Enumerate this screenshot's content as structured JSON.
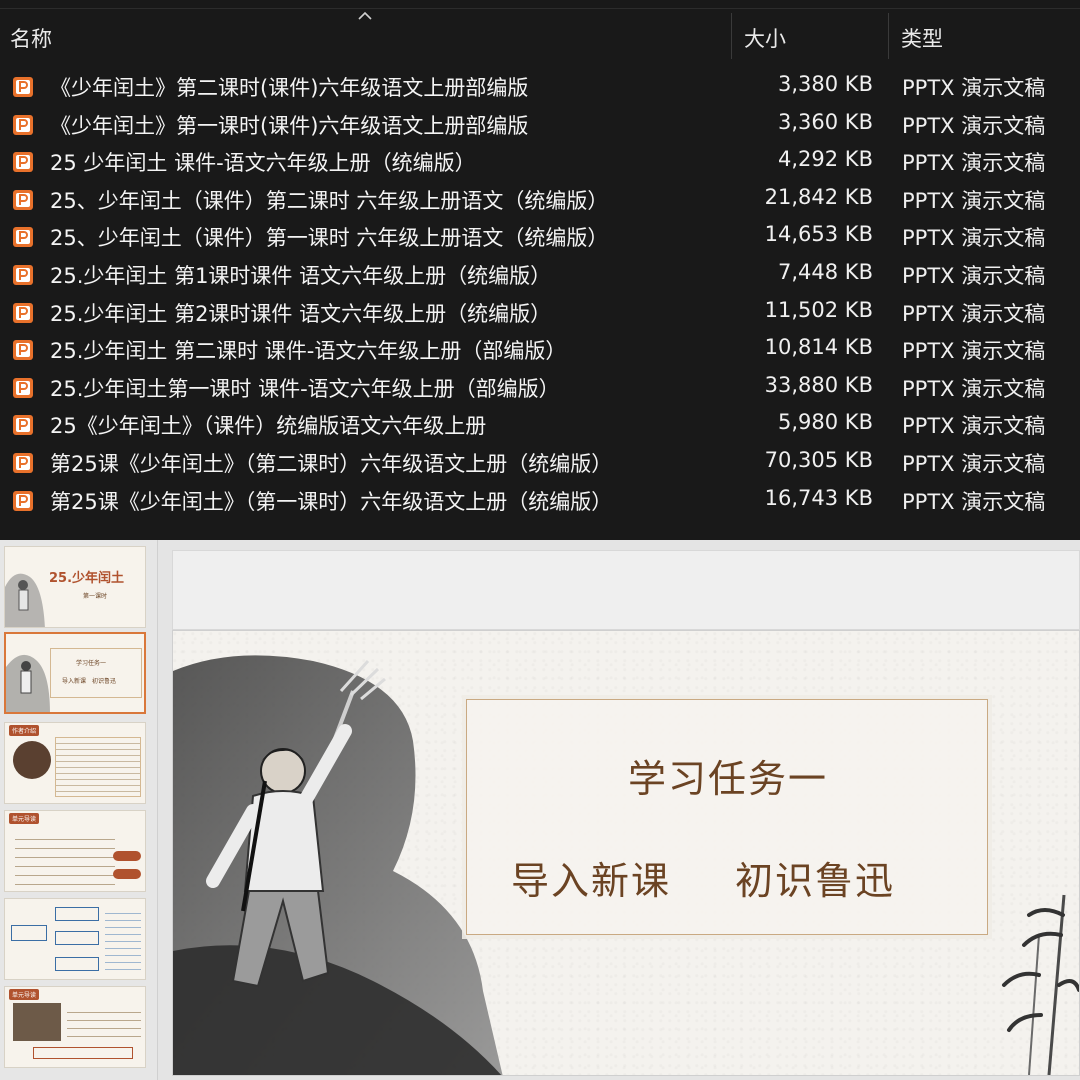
{
  "explorer": {
    "columns": {
      "name": "名称",
      "size": "大小",
      "type": "类型"
    },
    "files": [
      {
        "name": "《少年闰土》第二课时(课件)六年级语文上册部编版",
        "size": "3,380 KB",
        "type": "PPTX 演示文稿"
      },
      {
        "name": "《少年闰土》第一课时(课件)六年级语文上册部编版",
        "size": "3,360 KB",
        "type": "PPTX 演示文稿"
      },
      {
        "name": "25 少年闰土 课件-语文六年级上册（统编版）",
        "size": "4,292 KB",
        "type": "PPTX 演示文稿"
      },
      {
        "name": "25、少年闰土（课件）第二课时 六年级上册语文（统编版）",
        "size": "21,842 KB",
        "type": "PPTX 演示文稿"
      },
      {
        "name": "25、少年闰土（课件）第一课时 六年级上册语文（统编版）",
        "size": "14,653 KB",
        "type": "PPTX 演示文稿"
      },
      {
        "name": "25.少年闰土 第1课时课件 语文六年级上册（统编版）",
        "size": "7,448 KB",
        "type": "PPTX 演示文稿"
      },
      {
        "name": "25.少年闰土 第2课时课件 语文六年级上册（统编版）",
        "size": "11,502 KB",
        "type": "PPTX 演示文稿"
      },
      {
        "name": "25.少年闰土 第二课时 课件-语文六年级上册（部编版）",
        "size": "10,814 KB",
        "type": "PPTX 演示文稿"
      },
      {
        "name": "25.少年闰土第一课时 课件-语文六年级上册（部编版）",
        "size": "33,880 KB",
        "type": "PPTX 演示文稿"
      },
      {
        "name": "25《少年闰土》（课件）统编版语文六年级上册",
        "size": "5,980 KB",
        "type": "PPTX 演示文稿"
      },
      {
        "name": "第25课《少年闰土》（第二课时）六年级语文上册（统编版）",
        "size": "70,305 KB",
        "type": "PPTX 演示文稿"
      },
      {
        "name": "第25课《少年闰土》（第一课时）六年级语文上册（统编版）",
        "size": "16,743 KB",
        "type": "PPTX 演示文稿"
      }
    ],
    "icon": "powerpoint-file-icon",
    "accent": "#e8712b"
  },
  "ppt": {
    "thumbnails": [
      {
        "title": "25.少年闰土",
        "subtitle": "第一课时"
      },
      {
        "line1": "学习任务一",
        "line2": "导入新课　初识鲁迅"
      },
      {
        "head": "作者介绍"
      },
      {
        "head": "单元导读"
      },
      {
        "head": ""
      },
      {
        "head": "单元导读"
      }
    ],
    "slide": {
      "line1": "学习任务一",
      "line2a": "导入新课",
      "line2b": "初识鲁迅"
    },
    "colors": {
      "title": "#6b4323",
      "frame": "#c9a982",
      "thumb_selected": "#d9773a"
    }
  }
}
